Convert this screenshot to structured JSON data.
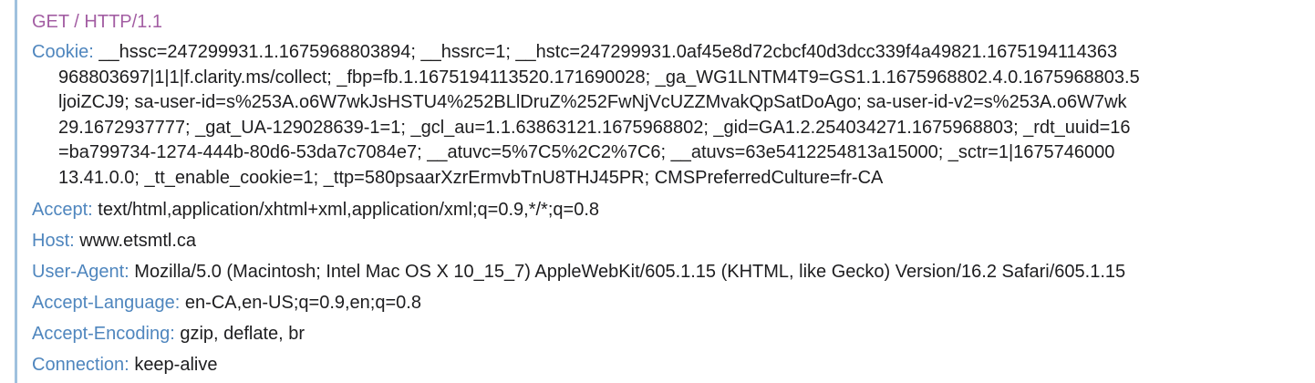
{
  "request_line": "GET / HTTP/1.1",
  "cookie": {
    "key": "Cookie:",
    "lines": [
      "__hssc=247299931.1.1675968803894; __hssrc=1; __hstc=247299931.0af45e8d72cbcf40d3dcc339f4a49821.1675194114363",
      "968803697|1|1|f.clarity.ms/collect; _fbp=fb.1.1675194113520.171690028; _ga_WG1LNTM4T9=GS1.1.1675968802.4.0.1675968803.5",
      "ljoiZCJ9; sa-user-id=s%253A.o6W7wkJsHSTU4%252BLlDruZ%252FwNjVcUZZMvakQpSatDoAgo; sa-user-id-v2=s%253A.o6W7wk",
      "29.1672937777; _gat_UA-129028639-1=1; _gcl_au=1.1.63863121.1675968802; _gid=GA1.2.254034271.1675968803; _rdt_uuid=16",
      "=ba799734-1274-444b-80d6-53da7c7084e7; __atuvc=5%7C5%2C2%7C6; __atuvs=63e5412254813a15000; _sctr=1|1675746000",
      "13.41.0.0; _tt_enable_cookie=1; _ttp=580psaarXzrErmvbTnU8THJ45PR; CMSPreferredCulture=fr-CA"
    ]
  },
  "headers": [
    {
      "key": "Accept:",
      "value": "text/html,application/xhtml+xml,application/xml;q=0.9,*/*;q=0.8"
    },
    {
      "key": "Host:",
      "value": "www.etsmtl.ca"
    },
    {
      "key": "User-Agent:",
      "value": "Mozilla/5.0 (Macintosh; Intel Mac OS X 10_15_7) AppleWebKit/605.1.15 (KHTML, like Gecko) Version/16.2 Safari/605.1.15"
    },
    {
      "key": "Accept-Language:",
      "value": "en-CA,en-US;q=0.9,en;q=0.8"
    },
    {
      "key": "Accept-Encoding:",
      "value": "gzip, deflate, br"
    },
    {
      "key": "Connection:",
      "value": "keep-alive"
    }
  ],
  "colors": {
    "request_line": "#a35ea3",
    "header_key": "#4f86be",
    "value_text": "#1d1d1f",
    "left_rule": "#9fc1de"
  }
}
